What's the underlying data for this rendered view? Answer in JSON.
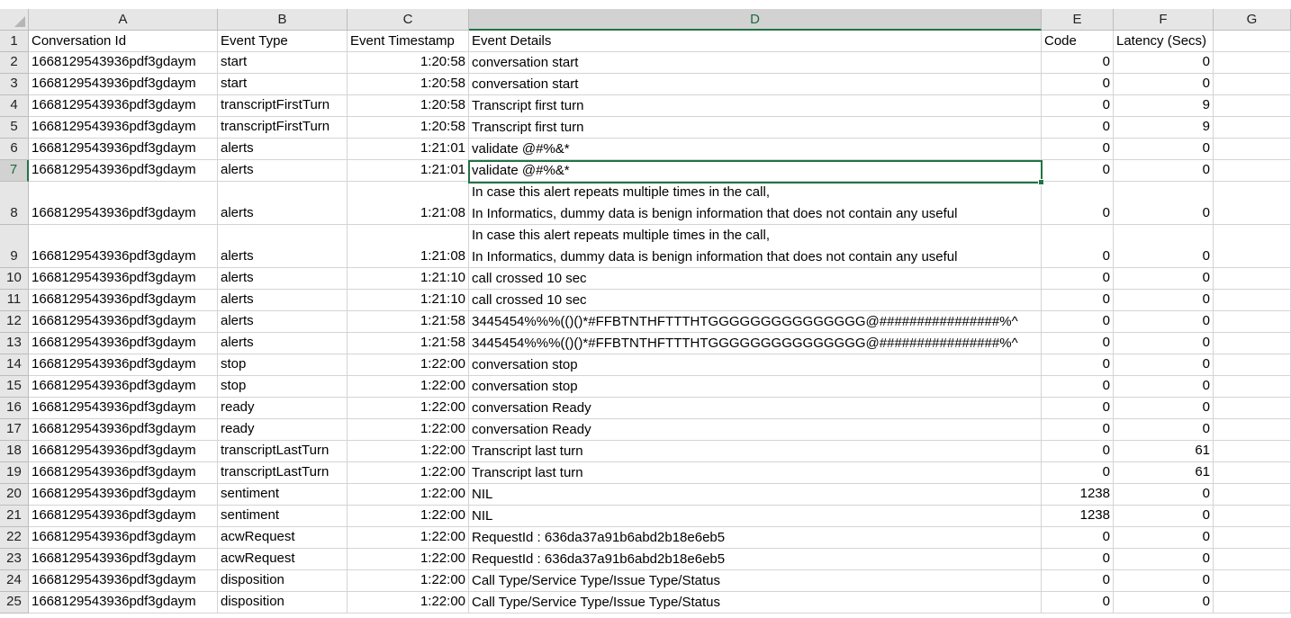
{
  "columns": [
    "A",
    "B",
    "C",
    "D",
    "E",
    "F",
    "G"
  ],
  "selected_col": "D",
  "selected_row": 7,
  "header_row": {
    "num": "1",
    "cells": [
      "Conversation Id",
      "Event Type",
      "Event Timestamp",
      "Event Details",
      "Code",
      "Latency (Secs)",
      ""
    ]
  },
  "rows": [
    {
      "num": "2",
      "id": "1668129543936pdf3gdaym",
      "type": "start",
      "ts": "1:20:58",
      "details": [
        "conversation start"
      ],
      "code": "0",
      "latency": "0"
    },
    {
      "num": "3",
      "id": "1668129543936pdf3gdaym",
      "type": "start",
      "ts": "1:20:58",
      "details": [
        "conversation start"
      ],
      "code": "0",
      "latency": "0"
    },
    {
      "num": "4",
      "id": "1668129543936pdf3gdaym",
      "type": "transcriptFirstTurn",
      "ts": "1:20:58",
      "details": [
        "Transcript first turn"
      ],
      "code": "0",
      "latency": "9"
    },
    {
      "num": "5",
      "id": "1668129543936pdf3gdaym",
      "type": "transcriptFirstTurn",
      "ts": "1:20:58",
      "details": [
        "Transcript first turn"
      ],
      "code": "0",
      "latency": "9"
    },
    {
      "num": "6",
      "id": "1668129543936pdf3gdaym",
      "type": "alerts",
      "ts": "1:21:01",
      "details": [
        "validate @#%&*"
      ],
      "code": "0",
      "latency": "0"
    },
    {
      "num": "7",
      "id": "1668129543936pdf3gdaym",
      "type": "alerts",
      "ts": "1:21:01",
      "details": [
        "validate @#%&*"
      ],
      "code": "0",
      "latency": "0"
    },
    {
      "num": "8",
      "id": "1668129543936pdf3gdaym",
      "type": "alerts",
      "ts": "1:21:08",
      "details": [
        "In case this alert repeats multiple times in the call,",
        "In Informatics, dummy data is benign information that does not contain any useful"
      ],
      "code": "0",
      "latency": "0"
    },
    {
      "num": "9",
      "id": "1668129543936pdf3gdaym",
      "type": "alerts",
      "ts": "1:21:08",
      "details": [
        "In case this alert repeats multiple times in the call,",
        "In Informatics, dummy data is benign information that does not contain any useful"
      ],
      "code": "0",
      "latency": "0"
    },
    {
      "num": "10",
      "id": "1668129543936pdf3gdaym",
      "type": "alerts",
      "ts": "1:21:10",
      "details": [
        "call crossed 10 sec"
      ],
      "code": "0",
      "latency": "0"
    },
    {
      "num": "11",
      "id": "1668129543936pdf3gdaym",
      "type": "alerts",
      "ts": "1:21:10",
      "details": [
        "call crossed 10 sec"
      ],
      "code": "0",
      "latency": "0"
    },
    {
      "num": "12",
      "id": "1668129543936pdf3gdaym",
      "type": "alerts",
      "ts": "1:21:58",
      "details": [
        "3445454%%%(()()*#FFBTNTHFTTTHTGGGGGGGGGGGGGGG@################%^"
      ],
      "code": "0",
      "latency": "0"
    },
    {
      "num": "13",
      "id": "1668129543936pdf3gdaym",
      "type": "alerts",
      "ts": "1:21:58",
      "details": [
        "3445454%%%(()()*#FFBTNTHFTTTHTGGGGGGGGGGGGGGG@################%^"
      ],
      "code": "0",
      "latency": "0"
    },
    {
      "num": "14",
      "id": "1668129543936pdf3gdaym",
      "type": "stop",
      "ts": "1:22:00",
      "details": [
        "conversation stop"
      ],
      "code": "0",
      "latency": "0"
    },
    {
      "num": "15",
      "id": "1668129543936pdf3gdaym",
      "type": "stop",
      "ts": "1:22:00",
      "details": [
        "conversation stop"
      ],
      "code": "0",
      "latency": "0"
    },
    {
      "num": "16",
      "id": "1668129543936pdf3gdaym",
      "type": "ready",
      "ts": "1:22:00",
      "details": [
        "conversation Ready"
      ],
      "code": "0",
      "latency": "0"
    },
    {
      "num": "17",
      "id": "1668129543936pdf3gdaym",
      "type": "ready",
      "ts": "1:22:00",
      "details": [
        "conversation Ready"
      ],
      "code": "0",
      "latency": "0"
    },
    {
      "num": "18",
      "id": "1668129543936pdf3gdaym",
      "type": "transcriptLastTurn",
      "ts": "1:22:00",
      "details": [
        "Transcript last turn"
      ],
      "code": "0",
      "latency": "61"
    },
    {
      "num": "19",
      "id": "1668129543936pdf3gdaym",
      "type": "transcriptLastTurn",
      "ts": "1:22:00",
      "details": [
        "Transcript last turn"
      ],
      "code": "0",
      "latency": "61"
    },
    {
      "num": "20",
      "id": "1668129543936pdf3gdaym",
      "type": "sentiment",
      "ts": "1:22:00",
      "details": [
        "NIL"
      ],
      "code": "1238",
      "latency": "0"
    },
    {
      "num": "21",
      "id": "1668129543936pdf3gdaym",
      "type": "sentiment",
      "ts": "1:22:00",
      "details": [
        "NIL"
      ],
      "code": "1238",
      "latency": "0"
    },
    {
      "num": "22",
      "id": "1668129543936pdf3gdaym",
      "type": "acwRequest",
      "ts": "1:22:00",
      "details": [
        "RequestId : 636da37a91b6abd2b18e6eb5"
      ],
      "code": "0",
      "latency": "0"
    },
    {
      "num": "23",
      "id": "1668129543936pdf3gdaym",
      "type": "acwRequest",
      "ts": "1:22:00",
      "details": [
        "RequestId : 636da37a91b6abd2b18e6eb5"
      ],
      "code": "0",
      "latency": "0"
    },
    {
      "num": "24",
      "id": "1668129543936pdf3gdaym",
      "type": "disposition",
      "ts": "1:22:00",
      "details": [
        "Call Type/Service Type/Issue Type/Status"
      ],
      "code": "0",
      "latency": "0"
    },
    {
      "num": "25",
      "id": "1668129543936pdf3gdaym",
      "type": "disposition",
      "ts": "1:22:00",
      "details": [
        "Call Type/Service Type/Issue Type/Status"
      ],
      "code": "0",
      "latency": "0"
    }
  ],
  "colors": {
    "accent": "#217346",
    "header_bg": "#e6e6e6",
    "grid": "#d4d4d4"
  }
}
